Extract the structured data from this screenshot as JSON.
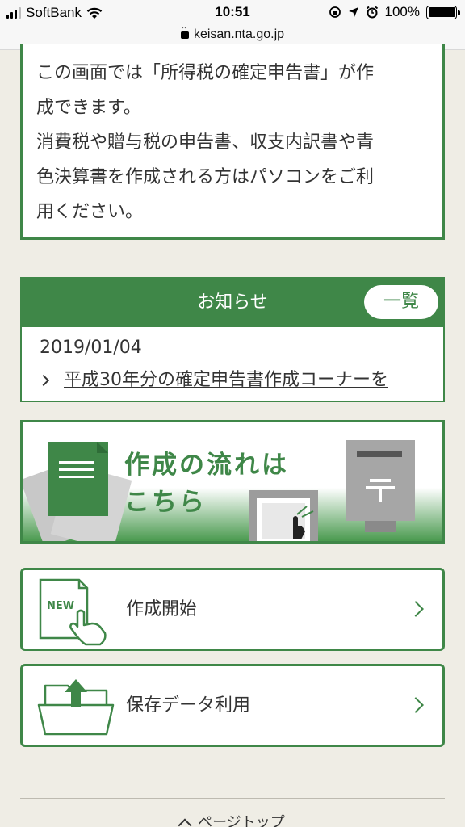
{
  "status_bar": {
    "carrier": "SoftBank",
    "time": "10:51",
    "battery": "100%"
  },
  "url_bar": {
    "host": "keisan.nta.go.jp"
  },
  "info": {
    "lines": [
      "この画面では「所得税の確定申告書」が作",
      "成できます。",
      "消費税や贈与税の申告書、収支内訳書や青",
      "色決算書を作成される方はパソコンをご利",
      "用ください。"
    ]
  },
  "news": {
    "heading": "お知らせ",
    "list_button": "一覧",
    "date": "2019/01/04",
    "item": "平成30年分の確定申告書作成コーナーを"
  },
  "banner": {
    "line1": "作成の流れは",
    "line2": "こちら"
  },
  "menu": {
    "start": {
      "label": "作成開始",
      "icon_text": "NEW"
    },
    "saved": {
      "label": "保存データ利用"
    }
  },
  "footer": {
    "page_top": "ページトップ"
  },
  "colors": {
    "accent": "#3f8748",
    "background": "#efede5"
  }
}
